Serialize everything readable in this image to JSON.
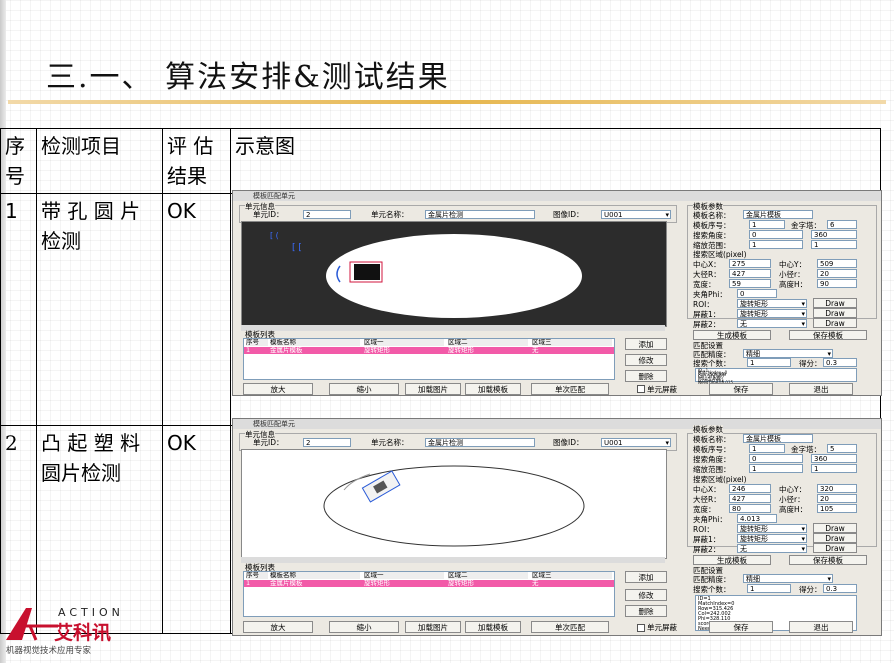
{
  "slide": {
    "title": "三.一、 算法安排&测试结果",
    "table": {
      "headers": [
        "序号",
        "检测项目",
        "评 估结果",
        "示意图"
      ],
      "header_col1": [
        "序",
        "号"
      ],
      "header_col3": [
        "评 估",
        "结果"
      ],
      "rows": [
        {
          "no": "1",
          "item": [
            "带 孔 圆 片",
            "检测"
          ],
          "result": "OK"
        },
        {
          "no": "2",
          "item": [
            "凸 起 塑 料",
            "圆片检测"
          ],
          "result": "OK"
        }
      ]
    }
  },
  "windows": [
    {
      "title": "模板匹配单元",
      "unit_info": "单元信息",
      "unit_id_label": "单元ID：",
      "unit_id": "2",
      "unit_name_label": "单元名称：",
      "unit_name": "金属片检测",
      "image_id_label": "图像ID：",
      "image_id": "U001",
      "template_params": "模板参数",
      "template_name_label": "模板名称：",
      "template_name": "金属片模板",
      "template_no_label": "模板序号：",
      "template_no": "1",
      "pyramid_label": "金字塔：",
      "pyramid": "6",
      "search_angle_label": "搜索角度：",
      "angle_from": "0",
      "angle_to": "360",
      "scale_label": "缩放范围：",
      "scale_from": "1",
      "scale_to": "1",
      "search_region": "搜索区域(pixel)",
      "cx_label": "中心X：",
      "cx": "275",
      "cy_label": "中心Y：",
      "cy": "509",
      "rmax_label": "大径R：",
      "rmax": "427",
      "rmin_label": "小径r：",
      "rmin": "20",
      "width_label": "宽度：",
      "width": "59",
      "height_label": "高度H：",
      "height": "90",
      "phi_label": "夹角Phi：",
      "phi": "0",
      "roi_label": "ROI：",
      "roi": "旋转矩形",
      "mask1_label": "屏蔽1：",
      "mask1": "旋转矩形",
      "mask2_label": "屏蔽2：",
      "mask2": "无",
      "draw": "Draw",
      "gen_template": "生成模板",
      "save_template": "保存模板",
      "match_settings": "匹配设置",
      "match_precision_label": "匹配精度：",
      "match_precision": "精细",
      "search_count_label": "搜索个数：",
      "search_count": "1",
      "score_label": "得分：",
      "score": "0.3",
      "result_text": "ID=1\nMatchIndex=0\nRow=509.999\nCol=274.997\nPhi=-0.000\nscore=0.983\nNeedTime=0.015",
      "template_list": "模板列表",
      "list_headers": [
        "序号",
        "模板名称",
        "区域一",
        "区域二",
        "区域三"
      ],
      "list_row": [
        "1",
        "金属片模板",
        "旋转矩形",
        "旋转矩形",
        "无"
      ],
      "add": "添加",
      "modify": "修改",
      "delete": "删除",
      "zoom_in": "放大",
      "zoom_out": "缩小",
      "load_image": "加载图片",
      "load_template": "加载模板",
      "single_match": "单次匹配",
      "unit_mask": "单元屏蔽",
      "save": "保存",
      "exit": "退出"
    },
    {
      "title": "模板匹配单元",
      "unit_info": "单元信息",
      "unit_id_label": "单元ID：",
      "unit_id": "2",
      "unit_name_label": "单元名称：",
      "unit_name": "金属片检测",
      "image_id_label": "图像ID：",
      "image_id": "U001",
      "template_params": "模板参数",
      "template_name_label": "模板名称：",
      "template_name": "金属片模板",
      "template_no_label": "模板序号：",
      "template_no": "1",
      "pyramid_label": "金字塔：",
      "pyramid": "5",
      "search_angle_label": "搜索角度：",
      "angle_from": "0",
      "angle_to": "360",
      "scale_label": "缩放范围：",
      "scale_from": "1",
      "scale_to": "1",
      "search_region": "搜索区域(pixel)",
      "cx_label": "中心X：",
      "cx": "246",
      "cy_label": "中心Y：",
      "cy": "320",
      "rmax_label": "大径R：",
      "rmax": "427",
      "rmin_label": "小径r：",
      "rmin": "20",
      "width_label": "宽度：",
      "width": "80",
      "height_label": "高度H：",
      "height": "105",
      "phi_label": "夹角Phi：",
      "phi": "4.013",
      "roi_label": "ROI：",
      "roi": "旋转矩形",
      "mask1_label": "屏蔽1：",
      "mask1": "旋转矩形",
      "mask2_label": "屏蔽2：",
      "mask2": "无",
      "draw": "Draw",
      "gen_template": "生成模板",
      "save_template": "保存模板",
      "match_settings": "匹配设置",
      "match_precision_label": "匹配精度：",
      "match_precision": "精细",
      "search_count_label": "搜索个数：",
      "search_count": "1",
      "score_label": "得分：",
      "score": "0.3",
      "result_text": "ID=1\nMatchIndex=0\nRow=315.426\nCol=242.002\nPhi=328.110\nscore=0.972\nNeedTime=0.016",
      "template_list": "模板列表",
      "list_headers": [
        "序号",
        "模板名称",
        "区域一",
        "区域二",
        "区域三"
      ],
      "list_row": [
        "1",
        "金属片模板",
        "旋转矩形",
        "旋转矩形",
        "无"
      ],
      "add": "添加",
      "modify": "修改",
      "delete": "删除",
      "zoom_in": "放大",
      "zoom_out": "缩小",
      "load_image": "加载图片",
      "load_template": "加载模板",
      "single_match": "单次匹配",
      "unit_mask": "单元屏蔽",
      "save": "保存",
      "exit": "退出"
    }
  ],
  "logo": {
    "brand_en": "ACTION",
    "brand_cn": "艾科讯",
    "tagline": "机器视觉技术应用专家",
    "color": "#c8102e"
  },
  "colors": {
    "accent_rule": "#e6b64d",
    "list_highlight": "#f25aa8"
  }
}
